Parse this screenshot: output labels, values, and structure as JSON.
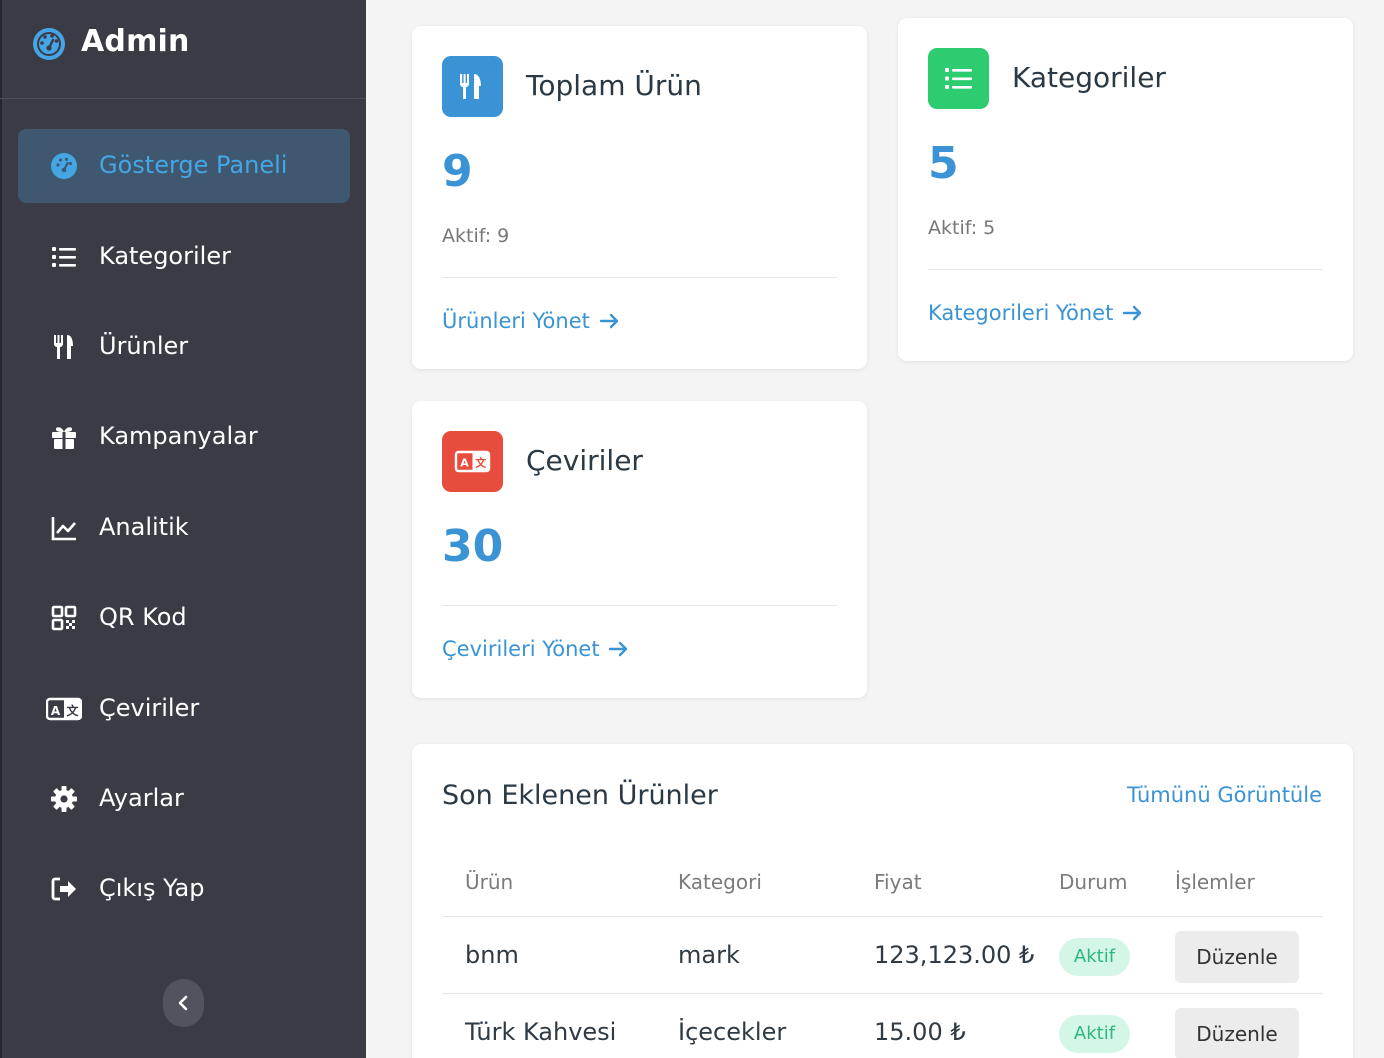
{
  "brand": {
    "title": "Admin",
    "icon": "dashboard-gauge-icon"
  },
  "sidebar": {
    "items": [
      {
        "label": "Gösterge Paneli",
        "icon": "dashboard-gauge-icon",
        "active": true
      },
      {
        "label": "Kategoriler",
        "icon": "list-icon",
        "active": false
      },
      {
        "label": "Ürünler",
        "icon": "utensils-icon",
        "active": false
      },
      {
        "label": "Kampanyalar",
        "icon": "gift-icon",
        "active": false
      },
      {
        "label": "Analitik",
        "icon": "line-chart-icon",
        "active": false
      },
      {
        "label": "QR Kod",
        "icon": "qrcode-icon",
        "active": false
      },
      {
        "label": "Çeviriler",
        "icon": "language-icon",
        "active": false
      },
      {
        "label": "Ayarlar",
        "icon": "gear-icon",
        "active": false
      },
      {
        "label": "Çıkış Yap",
        "icon": "logout-icon",
        "active": false
      }
    ],
    "collapse_icon": "chevron-left-icon"
  },
  "cards": {
    "products": {
      "title": "Toplam Ürün",
      "value": "9",
      "sub": "Aktif: 9",
      "link": "Ürünleri Yönet",
      "icon": "utensils-icon",
      "color": "#3a93d4"
    },
    "categories": {
      "title": "Kategoriler",
      "value": "5",
      "sub": "Aktif: 5",
      "link": "Kategorileri Yönet",
      "icon": "list-icon",
      "color": "#2ecc71"
    },
    "translations": {
      "title": "Çeviriler",
      "value": "30",
      "link": "Çevirileri Yönet",
      "icon": "language-icon",
      "color": "#e74c3c"
    }
  },
  "recent": {
    "title": "Son Eklenen Ürünler",
    "view_all": "Tümünü Görüntüle",
    "headers": [
      "Ürün",
      "Kategori",
      "Fiyat",
      "Durum",
      "İşlemler"
    ],
    "rows": [
      {
        "product": "bnm",
        "category": "mark",
        "price": "123,123.00 ₺",
        "status": "Aktif",
        "action": "Düzenle"
      },
      {
        "product": "Türk Kahvesi",
        "category": "İçecekler",
        "price": "15.00 ₺",
        "status": "Aktif",
        "action": "Düzenle"
      }
    ]
  },
  "colors": {
    "sidebar": "#3a3b45",
    "accent": "#3a93d4",
    "success": "#2db87d"
  }
}
